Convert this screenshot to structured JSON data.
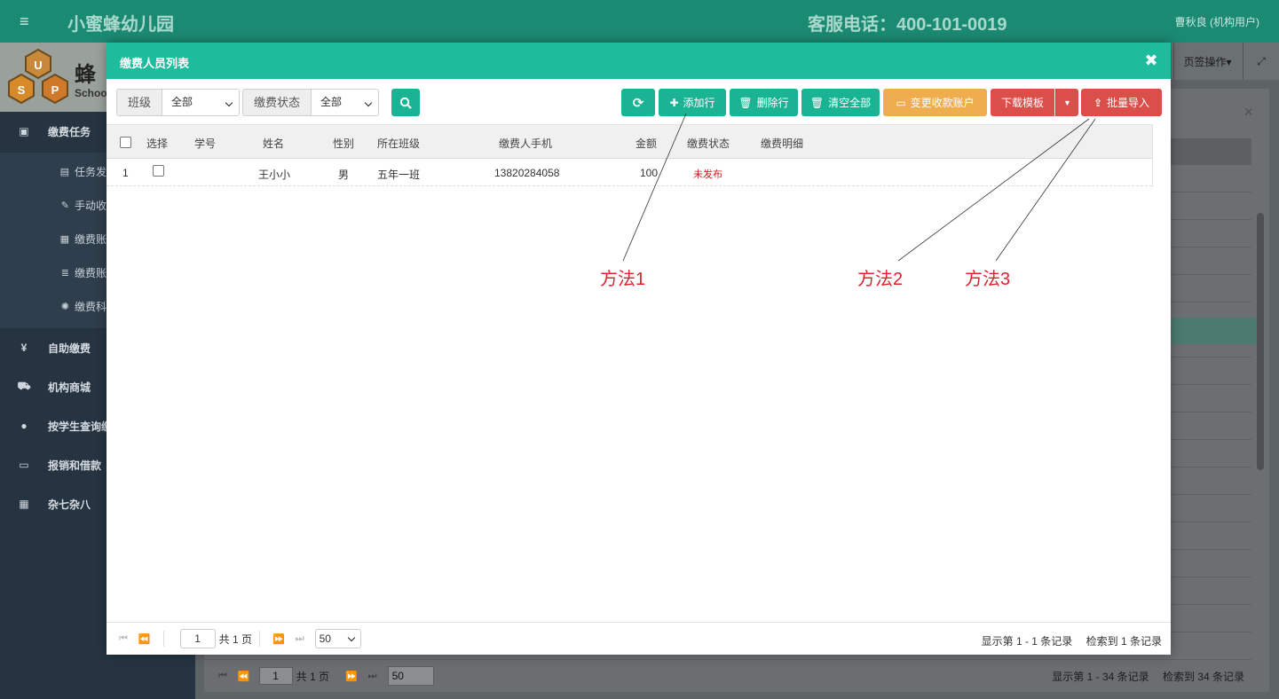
{
  "header": {
    "brand": "小蜜蜂幼儿园",
    "hotline": "客服电话：400-101-0019",
    "user": "曹秋良 (机构用户)",
    "menu_icon": "menu-icon"
  },
  "sidebar": {
    "logo_text": "蜂",
    "logo_sub": "Schoo",
    "group_label": "缴费任务",
    "sub_items": [
      {
        "label": "任务发",
        "icon": "file-check-icon"
      },
      {
        "label": "手动收",
        "icon": "edit-icon"
      },
      {
        "label": "缴费账",
        "icon": "document-icon"
      },
      {
        "label": "缴费账",
        "icon": "list-icon"
      },
      {
        "label": "缴费科",
        "icon": "gear-icon"
      }
    ],
    "items": [
      {
        "label": "自助缴费",
        "icon": "yen-icon"
      },
      {
        "label": "机构商城",
        "icon": "cart-icon"
      },
      {
        "label": "按学生查询缴",
        "icon": "user-icon"
      },
      {
        "label": "报销和借款",
        "icon": "card-icon"
      },
      {
        "label": "杂七杂八",
        "icon": "grid-icon"
      }
    ]
  },
  "tabs": {
    "page_ops": "页签操作▾"
  },
  "modal": {
    "title": "缴费人员列表",
    "filters": {
      "class_label": "班级",
      "class_value": "全部",
      "status_label": "缴费状态",
      "status_value": "全部"
    },
    "toolbar": {
      "refresh_icon": "refresh-icon",
      "add_row": "添加行",
      "delete_row": "删除行",
      "clear_all": "清空全部",
      "change_account": "变更收款账户",
      "download_template": "下载模板",
      "batch_import": "批量导入"
    },
    "columns": [
      "选择",
      "学号",
      "姓名",
      "性别",
      "所在班级",
      "缴费人手机",
      "金额",
      "缴费状态",
      "缴费明细"
    ],
    "rows": [
      {
        "index": "1",
        "student_no": "",
        "name": "王小小",
        "gender": "男",
        "class": "五年一班",
        "phone": "13820284058",
        "amount": "100",
        "status": "未发布",
        "detail": ""
      }
    ],
    "pager": {
      "page": "1",
      "total_pages": "共 1 页",
      "page_size": "50",
      "display": "显示第 1 - 1 条记录",
      "found": "检索到 1 条记录"
    }
  },
  "background_pager": {
    "page": "1",
    "total_pages": "共 1 页",
    "page_size": "50",
    "display": "显示第 1 - 34 条记录",
    "found": "检索到 34 条记录"
  },
  "annotations": [
    "方法1",
    "方法2",
    "方法3"
  ],
  "colors": {
    "header": "#1b8a73",
    "modal_header": "#1dbc9c",
    "teal_button": "#1ab394",
    "orange_button": "#f0ad4e",
    "red_button": "#da4f49",
    "status_red": "#d9161b",
    "annotation": "#e0212f"
  }
}
